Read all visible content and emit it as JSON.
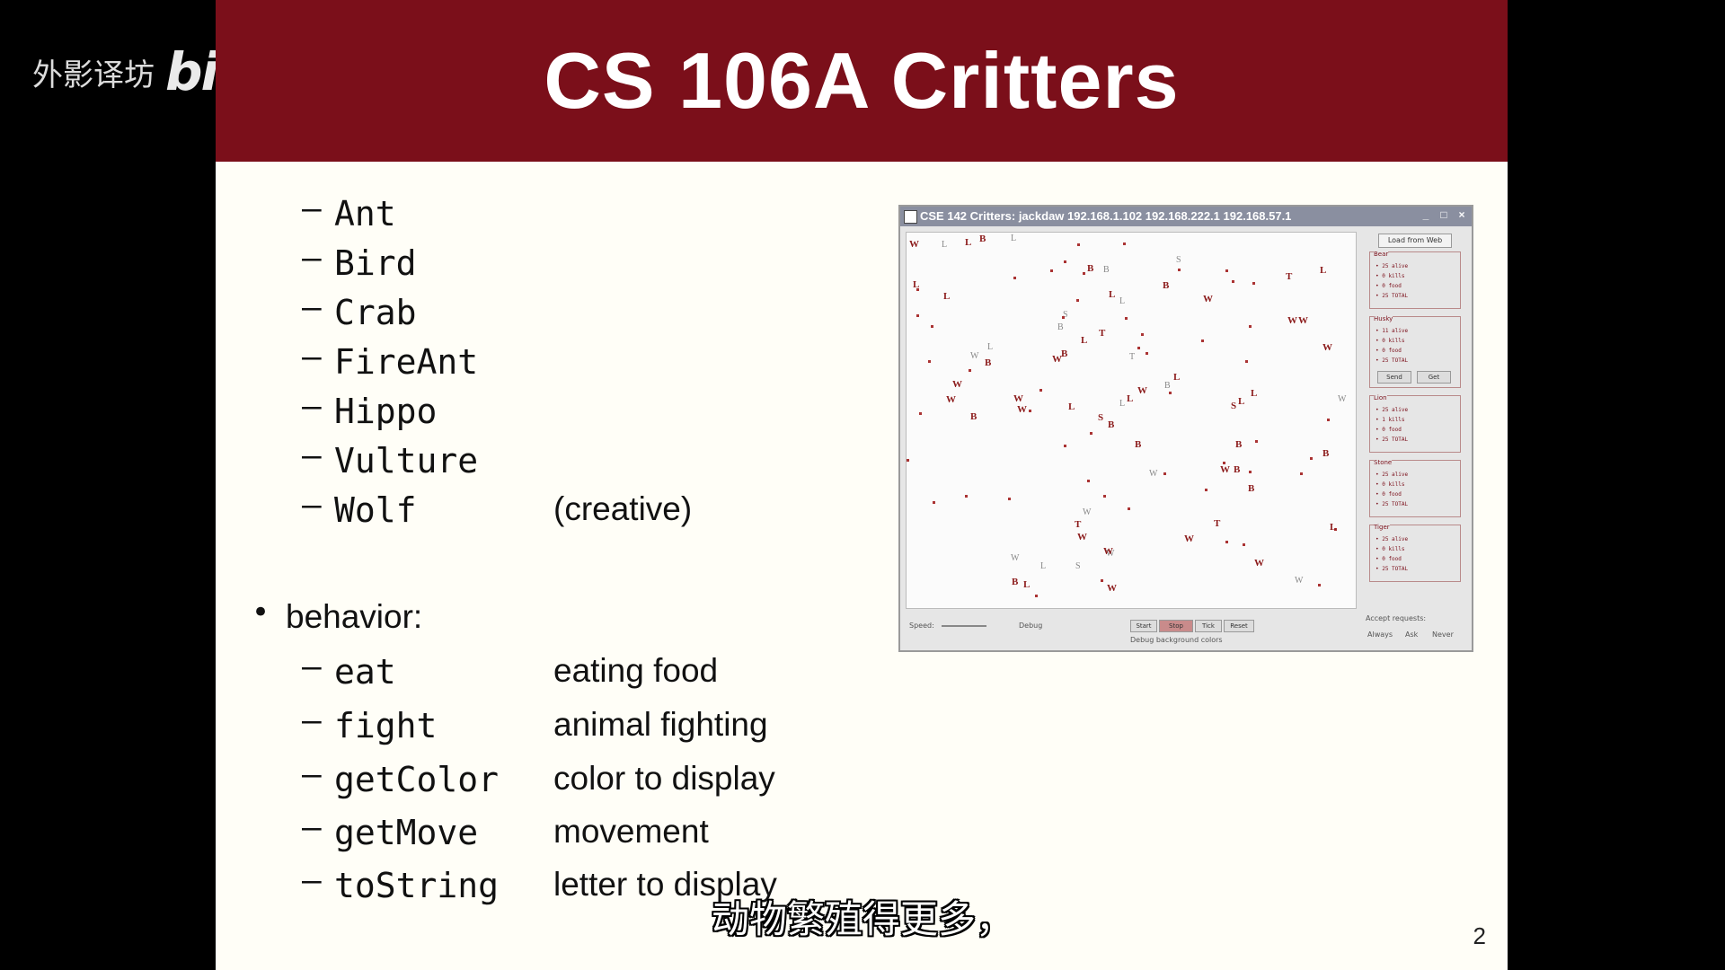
{
  "watermark": {
    "text": "外影译坊",
    "logo": "bilibili"
  },
  "slide": {
    "title": "CS 106A Critters",
    "page_number": "2",
    "critter_types": [
      "Ant",
      "Bird",
      "Crab",
      "FireAnt",
      "Hippo",
      "Vulture",
      "Wolf"
    ],
    "wolf_note": "(creative)",
    "behavior_label": "behavior:",
    "behaviors": [
      {
        "name": "eat",
        "desc": "eating food"
      },
      {
        "name": "fight",
        "desc": "animal fighting"
      },
      {
        "name": "getColor",
        "desc": "color to display"
      },
      {
        "name": "getMove",
        "desc": "movement"
      },
      {
        "name": "toString",
        "desc": "letter to display"
      }
    ],
    "dash": "–",
    "bullet": "•"
  },
  "screenshot": {
    "window_title": "CSE 142 Critters: jackdaw 192.168.1.102 192.168.222.1 192.168.57.1",
    "min": "_",
    "max": "□",
    "close": "×",
    "load_button": "Load from Web",
    "groups": [
      {
        "label": "Bear",
        "lines": [
          "• 25 alive",
          "• 0 kills",
          "• 0 food",
          "• 25 TOTAL"
        ]
      },
      {
        "label": "Husky",
        "lines": [
          "• 11 alive",
          "• 0 kills",
          "• 0 food",
          "• 25 TOTAL"
        ]
      },
      {
        "label": "Lion",
        "lines": [
          "• 25 alive",
          "• 1 kills",
          "• 0 food",
          "• 25 TOTAL"
        ]
      },
      {
        "label": "Stone",
        "lines": [
          "• 25 alive",
          "• 0 kills",
          "• 0 food",
          "• 25 TOTAL"
        ]
      },
      {
        "label": "Tiger",
        "lines": [
          "• 25 alive",
          "• 0 kills",
          "• 0 food",
          "• 25 TOTAL"
        ]
      }
    ],
    "husky_buttons": [
      "Send",
      "Get"
    ],
    "bottom": {
      "speed_label": "Speed:",
      "debug_label": "Debug",
      "buttons": [
        "Start",
        "Stop",
        "Tick",
        "Reset"
      ],
      "bg_label": "Debug background colors",
      "accept_label": "Accept requests:",
      "options": [
        "Always",
        "Ask",
        "Never"
      ]
    }
  },
  "subtitle": "动物繁殖得更多，"
}
